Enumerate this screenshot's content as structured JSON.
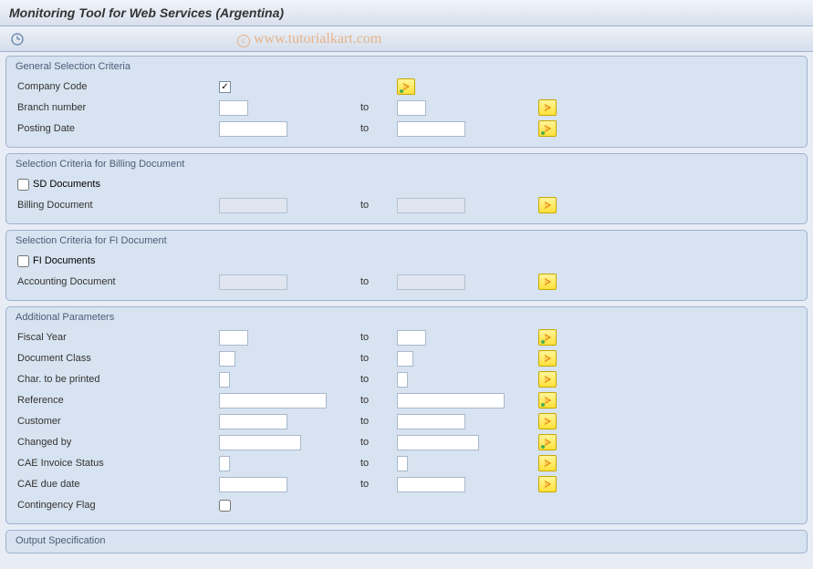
{
  "title": "Monitoring Tool for Web Services (Argentina)",
  "watermark": "www.tutorialkart.com",
  "groups": {
    "general": {
      "title": "General Selection Criteria",
      "company_code": "Company Code",
      "branch_number": "Branch number",
      "posting_date": "Posting Date"
    },
    "billing": {
      "title": "Selection Criteria for Billing Document",
      "sd_docs": "SD Documents",
      "billing_doc": "Billing Document"
    },
    "fi": {
      "title": "Selection Criteria for FI Document",
      "fi_docs": "FI Documents",
      "acct_doc": "Accounting Document"
    },
    "additional": {
      "title": "Additional Parameters",
      "fiscal_year": "Fiscal Year",
      "doc_class": "Document Class",
      "char_printed": "Char. to be printed",
      "reference": "Reference",
      "customer": "Customer",
      "changed_by": "Changed by",
      "cae_status": "CAE Invoice Status",
      "cae_due": "CAE due date",
      "contingency": "Contingency Flag"
    },
    "output": {
      "title": "Output Specification"
    }
  },
  "labels": {
    "to": "to"
  }
}
